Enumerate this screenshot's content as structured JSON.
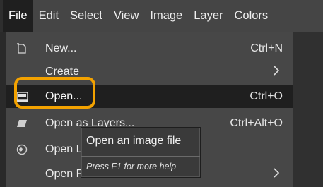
{
  "menubar": {
    "items": [
      "File",
      "Edit",
      "Select",
      "View",
      "Image",
      "Layer",
      "Colors"
    ]
  },
  "file_menu": {
    "items": [
      {
        "label": "New...",
        "accel": "Ctrl+N",
        "icon": "new-image-icon"
      },
      {
        "label": "Create",
        "accel": "",
        "submenu": true
      },
      {
        "label": "Open...",
        "accel": "Ctrl+O",
        "icon": "open-image-icon"
      },
      {
        "label": "Open as Layers...",
        "accel": "Ctrl+Alt+O",
        "icon": "open-as-layers-icon"
      },
      {
        "label": "Open Location...",
        "accel": "",
        "icon": "open-location-icon"
      },
      {
        "label": "Open Recent",
        "accel": "",
        "submenu": true
      }
    ],
    "submenu_arrow": "›"
  },
  "tooltip": {
    "text": "Open an image file",
    "hint": "Press F1 for more help"
  },
  "colors": {
    "highlight_ring": "#f3a200",
    "hover_bg": "#1f1f1f",
    "menu_bg": "#474747"
  }
}
